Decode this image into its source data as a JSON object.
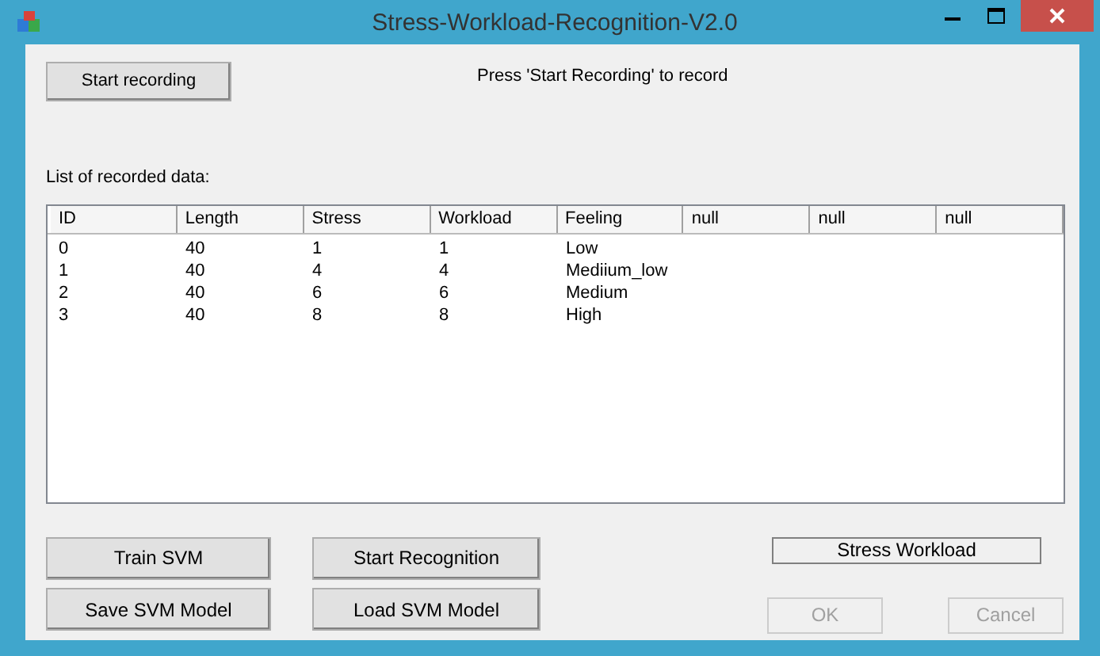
{
  "window": {
    "title": "Stress-Workload-Recognition-V2.0"
  },
  "start_button": {
    "label": "Start recording",
    "disabled": false
  },
  "hint": "Press 'Start Recording' to record",
  "list_label": "List of recorded data:",
  "table": {
    "columns": [
      "ID",
      "Length",
      "Stress",
      "Workload",
      "Feeling",
      "null",
      "null",
      "null"
    ],
    "rows": [
      [
        "0",
        "40",
        "1",
        "1",
        "Low"
      ],
      [
        "1",
        "40",
        "4",
        "4",
        "Mediium_low"
      ],
      [
        "2",
        "40",
        "6",
        "6",
        "Medium"
      ],
      [
        "3",
        "40",
        "8",
        "8",
        "High"
      ]
    ]
  },
  "buttons": [
    {
      "label": "Train SVM",
      "disabled": false
    },
    {
      "label": "Start Recognition",
      "disabled": false
    },
    {
      "label": "Save SVM Model",
      "disabled": false
    },
    {
      "label": "Load SVM Model",
      "disabled": false
    }
  ],
  "status": "Stress Workload",
  "dialog_buttons": [
    {
      "label": "OK",
      "disabled": true
    },
    {
      "label": "Cancel",
      "disabled": true
    }
  ]
}
